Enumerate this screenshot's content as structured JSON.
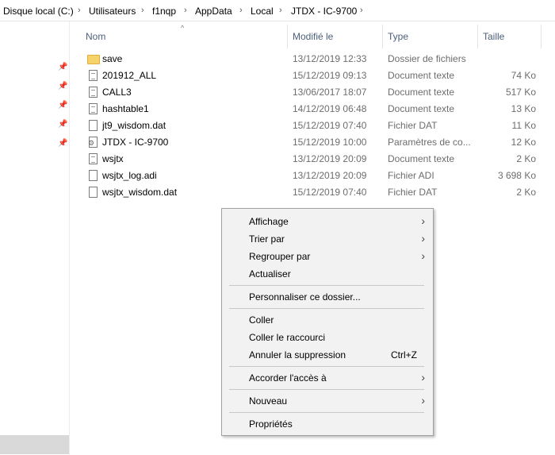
{
  "breadcrumb": [
    "Disque local (C:)",
    "Utilisateurs",
    "f1nqp",
    "AppData",
    "Local",
    "JTDX - IC-9700"
  ],
  "columns": {
    "name": "Nom",
    "modified": "Modifié le",
    "type": "Type",
    "size": "Taille"
  },
  "files": [
    {
      "name": "save",
      "date": "13/12/2019 12:33",
      "type": "Dossier de fichiers",
      "size": "",
      "icon": "folder-icon"
    },
    {
      "name": "201912_ALL",
      "date": "15/12/2019 09:13",
      "type": "Document texte",
      "size": "74 Ko",
      "icon": "text-file-icon"
    },
    {
      "name": "CALL3",
      "date": "13/06/2017 18:07",
      "type": "Document texte",
      "size": "517 Ko",
      "icon": "text-file-icon"
    },
    {
      "name": "hashtable1",
      "date": "14/12/2019 06:48",
      "type": "Document texte",
      "size": "13 Ko",
      "icon": "text-file-icon"
    },
    {
      "name": "jt9_wisdom.dat",
      "date": "15/12/2019 07:40",
      "type": "Fichier DAT",
      "size": "11 Ko",
      "icon": "file-icon"
    },
    {
      "name": "JTDX - IC-9700",
      "date": "15/12/2019 10:00",
      "type": "Paramètres de co...",
      "size": "12 Ko",
      "icon": "settings-file-icon"
    },
    {
      "name": "wsjtx",
      "date": "13/12/2019 20:09",
      "type": "Document texte",
      "size": "2 Ko",
      "icon": "text-file-icon"
    },
    {
      "name": "wsjtx_log.adi",
      "date": "13/12/2019 20:09",
      "type": "Fichier ADI",
      "size": "3 698 Ko",
      "icon": "file-icon"
    },
    {
      "name": "wsjtx_wisdom.dat",
      "date": "15/12/2019 07:40",
      "type": "Fichier DAT",
      "size": "2 Ko",
      "icon": "file-icon"
    }
  ],
  "context_menu": {
    "view": "Affichage",
    "sort_by": "Trier par",
    "group_by": "Regrouper par",
    "refresh": "Actualiser",
    "customize": "Personnaliser ce dossier...",
    "paste": "Coller",
    "paste_shortcut": "Coller le raccourci",
    "undo_delete": "Annuler la suppression",
    "undo_delete_shortcut": "Ctrl+Z",
    "give_access": "Accorder l'accès à",
    "new": "Nouveau",
    "properties": "Propriétés"
  },
  "colors": {
    "header_text": "#4c607a",
    "menu_bg": "#f2f2f2",
    "folder": "#f6d36a"
  }
}
